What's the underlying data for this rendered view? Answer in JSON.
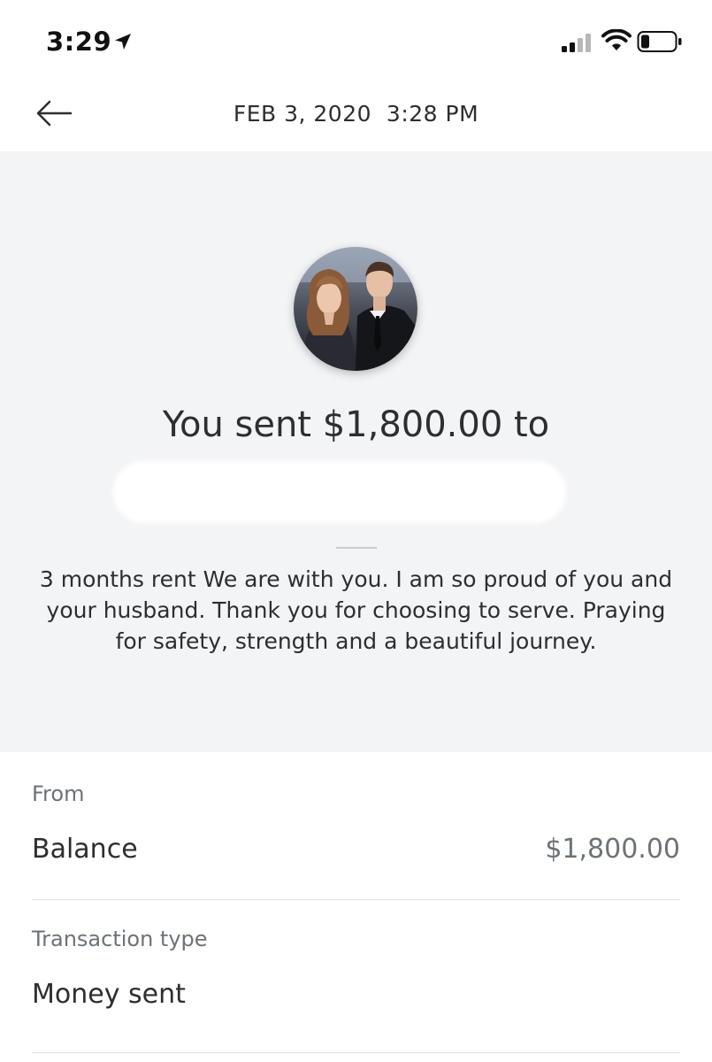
{
  "status_bar": {
    "time": "3:29"
  },
  "nav": {
    "title": "FEB 3, 2020  3:28 PM"
  },
  "transaction": {
    "heading": "You sent $1,800.00 to",
    "note": "3 months rent We are with you.  I am so proud of you and your husband.  Thank you for choosing to serve. Praying for safety, strength and a beautiful journey."
  },
  "details": {
    "from_label": "From",
    "from_value": "Balance",
    "from_amount": "$1,800.00",
    "type_label": "Transaction type",
    "type_value": "Money sent"
  },
  "colors": {
    "hero_background": "#f3f4f6",
    "text_primary": "#2c2e2f",
    "text_secondary": "#6c7378"
  },
  "icons": [
    "location-arrow-icon",
    "cellular-signal-icon",
    "wifi-icon",
    "battery-icon",
    "back-arrow-icon"
  ]
}
